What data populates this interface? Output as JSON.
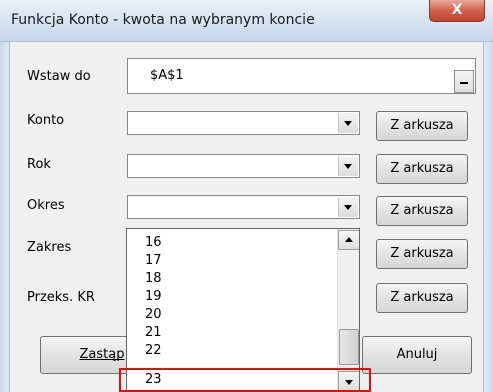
{
  "window": {
    "title": "Funkcja Konto - kwota na wybranym koncie",
    "close_label": "X"
  },
  "insert": {
    "label": "Wstaw do",
    "value": "$A$1",
    "picker_label": "_"
  },
  "konto": {
    "label": "Konto",
    "value": "",
    "from_sheet_label": "Z arkusza"
  },
  "rok": {
    "label": "Rok",
    "value": "",
    "from_sheet_label": "Z arkusza"
  },
  "okres": {
    "label": "Okres",
    "value": "",
    "from_sheet_label": "Z arkusza"
  },
  "zakres": {
    "label": "Zakres",
    "from_sheet_label": "Z arkusza"
  },
  "przeks": {
    "label": "Przeks. KR",
    "from_sheet_label": "Z arkusza"
  },
  "dropdown": {
    "items": [
      "16",
      "17",
      "18",
      "19",
      "20",
      "21",
      "22",
      "23"
    ],
    "highlighted": "23"
  },
  "buttons": {
    "replace_label": "Zastąp",
    "cancel_label": "Anuluj"
  },
  "colors": {
    "highlight_border": "#e01010",
    "titlebar": "#d5e3f2",
    "close_button": "#d4624c"
  }
}
